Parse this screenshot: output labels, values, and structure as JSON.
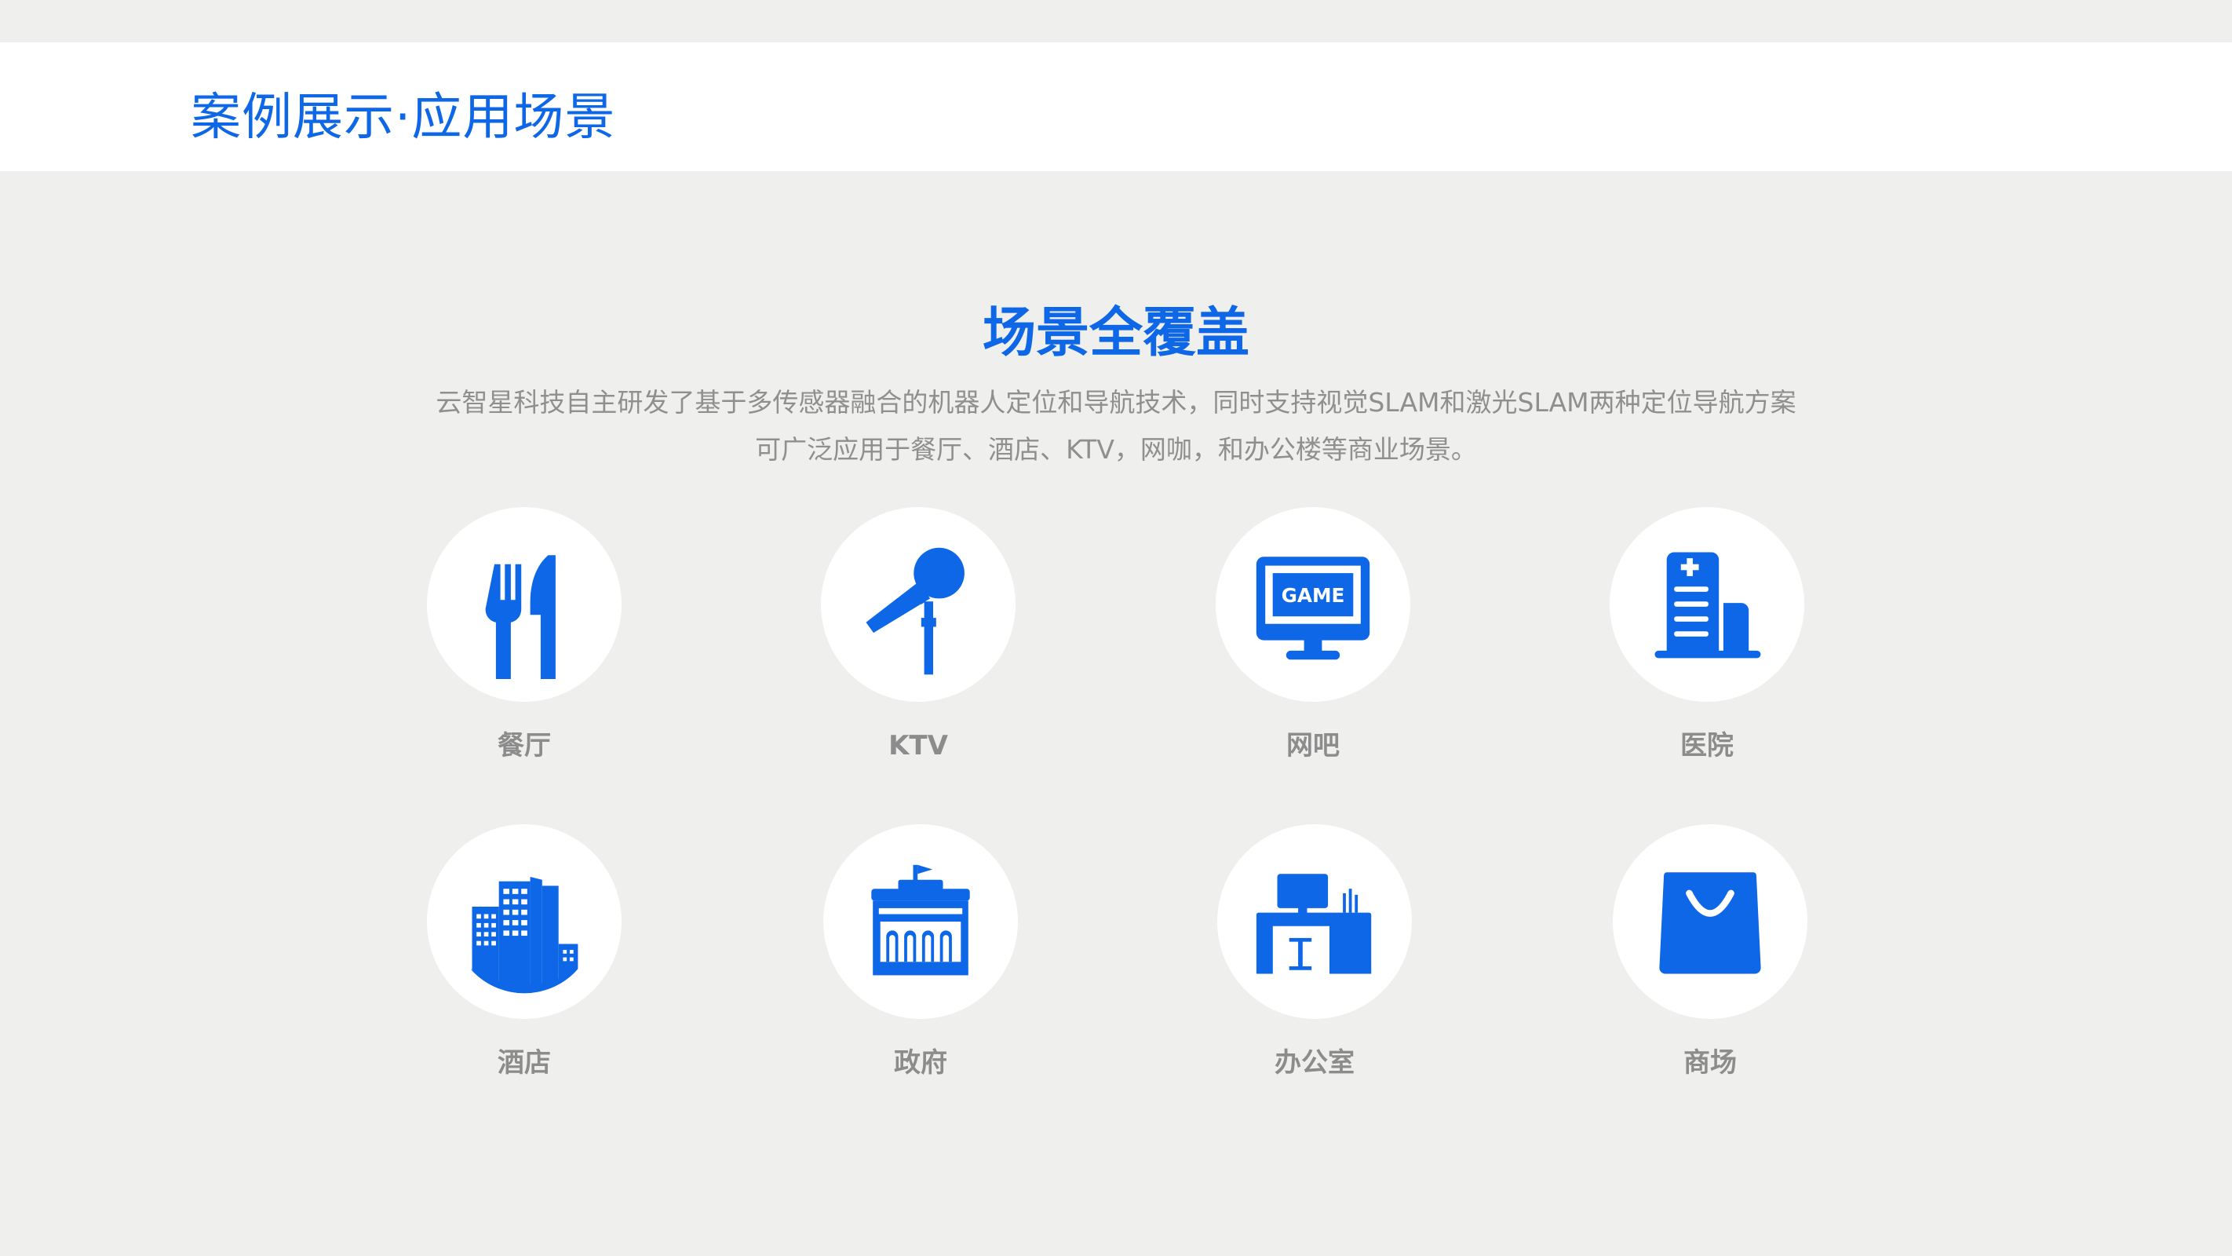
{
  "header": {
    "title": "案例展示·应用场景"
  },
  "section": {
    "title": "场景全覆盖",
    "description_line1": "云智星科技自主研发了基于多传感器融合的机器人定位和导航技术，同时支持视觉SLAM和激光SLAM两种定位导航方案",
    "description_line2": "可广泛应用于餐厅、酒店、KTV，网咖，和办公楼等商业场景。"
  },
  "accent_color": "#0e67e6",
  "scenes": [
    {
      "label": "餐厅",
      "icon": "fork-knife-icon"
    },
    {
      "label": "KTV",
      "icon": "microphone-icon"
    },
    {
      "label": "网吧",
      "icon": "game-monitor-icon"
    },
    {
      "label": "医院",
      "icon": "hospital-icon"
    },
    {
      "label": "酒店",
      "icon": "hotel-buildings-icon"
    },
    {
      "label": "政府",
      "icon": "government-building-icon"
    },
    {
      "label": "办公室",
      "icon": "office-desk-icon"
    },
    {
      "label": "商场",
      "icon": "shopping-bag-icon"
    }
  ],
  "game_screen_text": "GAME"
}
